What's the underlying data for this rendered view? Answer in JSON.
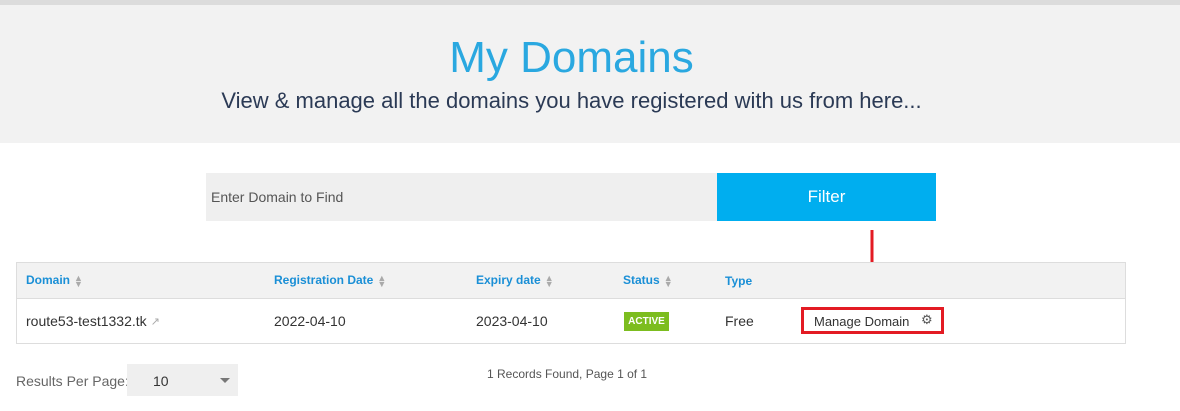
{
  "header": {
    "title": "My Domains",
    "subtitle": "View & manage all the domains you have registered with us from here..."
  },
  "search": {
    "placeholder": "Enter Domain to Find",
    "filter_label": "Filter"
  },
  "table": {
    "columns": [
      "Domain",
      "Registration Date",
      "Expiry date",
      "Status",
      "Type"
    ],
    "rows": [
      {
        "domain": "route53-test1332.tk",
        "registration_date": "2022-04-10",
        "expiry_date": "2023-04-10",
        "status": "ACTIVE",
        "type": "Free",
        "action_label": "Manage Domain"
      }
    ]
  },
  "footer": {
    "results_per_page_label": "Results Per Page:",
    "results_per_page_value": "10",
    "records_text": "1 Records Found, Page 1 of 1"
  },
  "colors": {
    "title": "#2aa8e0",
    "filter_button": "#00aeef",
    "status_active": "#7cbd1f",
    "highlight": "#e31b23",
    "link": "#1a8fd6"
  },
  "icons": [
    "sort-icon",
    "external-link-icon",
    "gear-icon",
    "arrow-down-icon",
    "chevron-down-icon"
  ]
}
